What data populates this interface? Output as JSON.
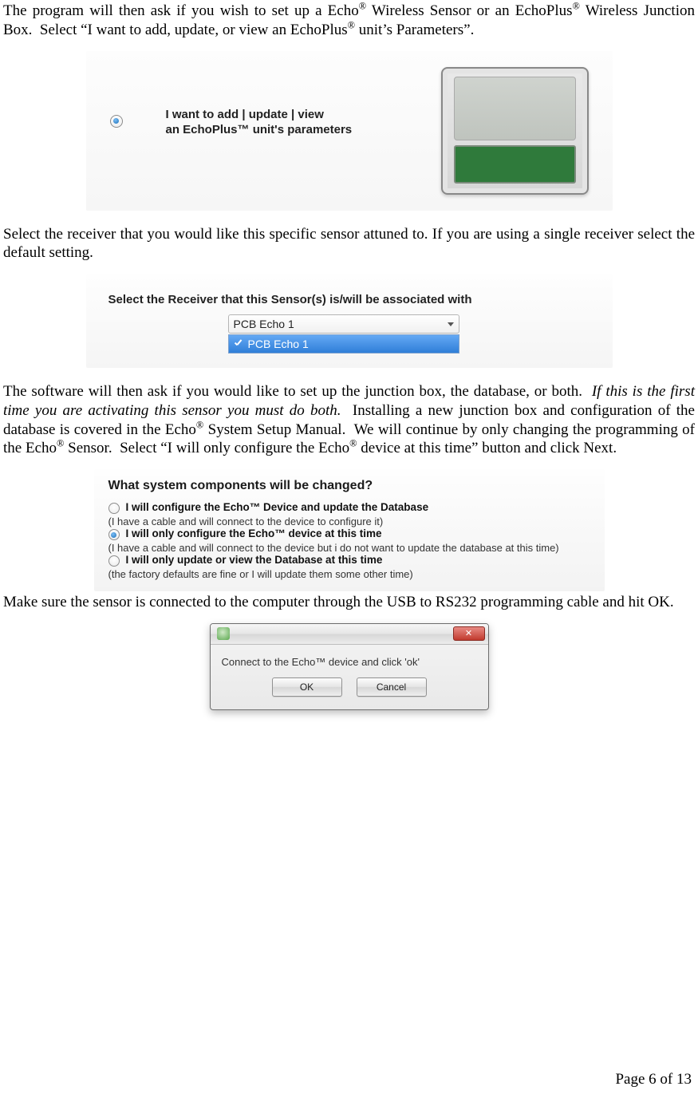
{
  "para1_html": "The program will then ask if you wish to set up a Echo<sup>®</sup> Wireless Sensor or an EchoPlus<sup>®</sup> Wireless Junction Box.&nbsp; Select “I want to add, update, or view an EchoPlus<sup>®</sup> unit’s Parameters”.",
  "fig1": {
    "line1": "I want to add | update | view",
    "line2": "an EchoPlus™ unit's parameters"
  },
  "para2": "Select the receiver that you would like this specific sensor attuned to.  If you are using a single receiver select the default setting.",
  "fig2": {
    "heading": "Select the Receiver that this Sensor(s) is/will be associated with",
    "combo_value": "PCB Echo 1",
    "options": [
      "PCB Echo 1"
    ]
  },
  "para3_html": "The software will then ask if you would like to set up the junction box, the database, or both.&nbsp; <span class=\"italic\">If this is the first time you are activating this sensor you must do both.</span>&nbsp; Installing a new junction box and configuration of the database is covered in the Echo<sup>®</sup> System Setup Manual.&nbsp; We will continue by only changing the programming of the Echo<sup>®</sup> Sensor.&nbsp; Select “I will only configure the Echo<sup>®</sup> device at this time” button and click Next.",
  "fig3": {
    "heading": "What system components will be changed?",
    "options": [
      {
        "main": "I will configure the Echo™ Device and update the Database",
        "sub": "(I have a cable and will connect to the device to configure it)",
        "selected": false
      },
      {
        "main": "I will only configure the Echo™ device at this time",
        "sub": "(I have a cable and will connect to the device but i do not want to update the database at this time)",
        "selected": true
      },
      {
        "main": "I will only update or view the Database at this time",
        "sub": "(the factory defaults are fine or I will update them some other time)",
        "selected": false
      }
    ]
  },
  "para4": "Make sure the sensor is connected to the computer through the USB to RS232 programming cable and hit OK.",
  "fig4": {
    "message": "Connect to the Echo™ device and click 'ok'",
    "ok": "OK",
    "cancel": "Cancel"
  },
  "footer": "Page 6 of 13"
}
